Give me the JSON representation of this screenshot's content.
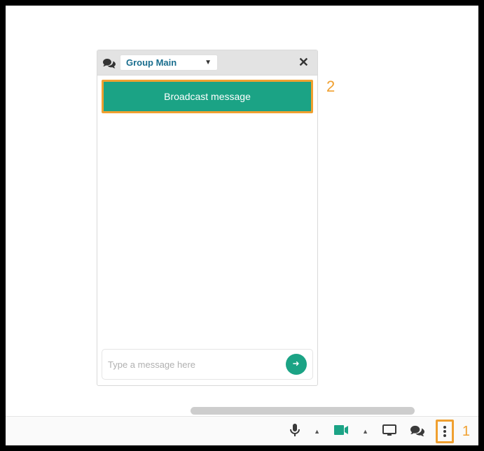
{
  "chat": {
    "group_selected": "Group Main",
    "broadcast_label": "Broadcast message",
    "input_placeholder": "Type a message here"
  },
  "annotations": {
    "step1": "1",
    "step2": "2"
  },
  "colors": {
    "accent": "#1ba385",
    "highlight": "#f0a030"
  }
}
